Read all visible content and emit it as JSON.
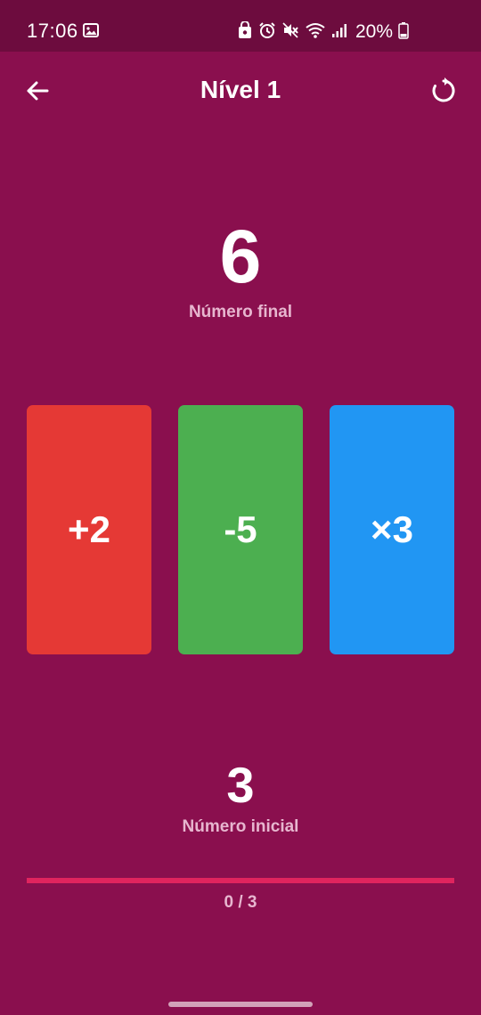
{
  "status_bar": {
    "time": "17:06",
    "battery": "20%",
    "icons": [
      "image-icon",
      "lock-bag-icon",
      "alarm-icon",
      "mute-icon",
      "wifi-icon",
      "signal-icon",
      "battery-icon"
    ]
  },
  "app_bar": {
    "title": "Nível 1",
    "back_icon": "arrow-left-icon",
    "reset_icon": "refresh-icon"
  },
  "target": {
    "value": "6",
    "label": "Número final"
  },
  "cards": [
    {
      "label": "+2",
      "color": "#e53935"
    },
    {
      "label": "-5",
      "color": "#4caf50"
    },
    {
      "label": "×3",
      "color": "#2196f3"
    }
  ],
  "start": {
    "value": "3",
    "label": "Número inicial"
  },
  "progress": {
    "text": "0 / 3",
    "fraction": 0
  },
  "colors": {
    "background": "#8a0f4e",
    "status_bar": "#6d0c3e",
    "progress_track": "#e0245e",
    "muted_text": "#e7b6cf"
  }
}
